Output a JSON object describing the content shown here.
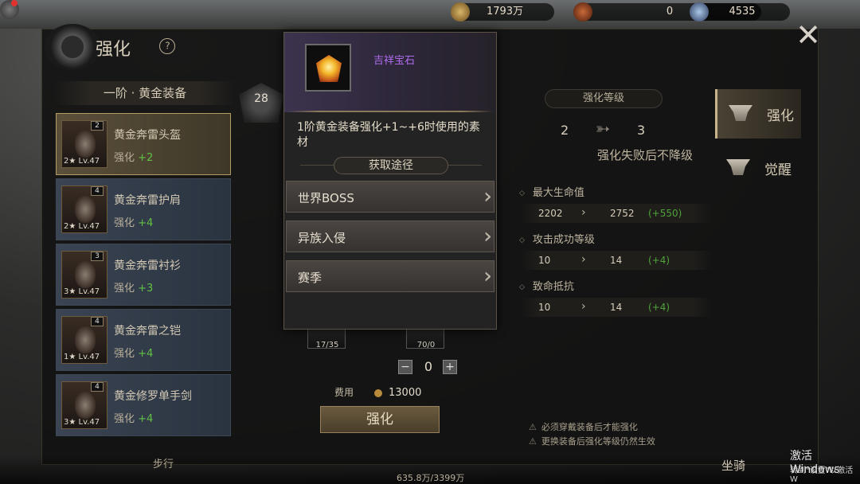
{
  "topbar": {
    "currency1": "1793万",
    "currency2": "0",
    "currency3": "4535"
  },
  "window": {
    "title": "强化",
    "help": "?",
    "close": "✕"
  },
  "list": {
    "header": "一阶 · 黄金装备",
    "items": [
      {
        "name": "黄金奔雷头盔",
        "count": "2",
        "lv": "2★ Lv.47",
        "enh": "+2"
      },
      {
        "name": "黄金奔雷护肩",
        "count": "4",
        "lv": "2★ Lv.47",
        "enh": "+4"
      },
      {
        "name": "黄金奔雷衬衫",
        "count": "3",
        "lv": "3★ Lv.47",
        "enh": "+3"
      },
      {
        "name": "黄金奔雷之铠",
        "count": "4",
        "lv": "1★ Lv.47",
        "enh": "+4"
      },
      {
        "name": "黄金修罗单手剑",
        "count": "4",
        "lv": "3★ Lv.47",
        "enh": "+4"
      }
    ],
    "enh_label": "强化"
  },
  "center": {
    "rank": "28",
    "mat1_count": "17/35",
    "mat2_count": "70/0",
    "stepper_minus": "−",
    "stepper_plus": "+",
    "stepper_value": "0",
    "cost_label": "费用",
    "cost_value": "13000",
    "enhance_button": "强化"
  },
  "stats": {
    "header": "强化等级",
    "from": "2",
    "to": "3",
    "no_drop": "强化失败后不降级",
    "rows": [
      {
        "title": "最大生命值",
        "a": "2202",
        "b": "2752",
        "d": "(+550)"
      },
      {
        "title": "攻击成功等级",
        "a": "10",
        "b": "14",
        "d": "(+4)"
      },
      {
        "title": "致命抵抗",
        "a": "10",
        "b": "14",
        "d": "(+4)"
      }
    ],
    "note1": "必须穿戴装备后才能强化",
    "note2": "更换装备后强化等级仍然生效"
  },
  "tabs": {
    "enhance": "强化",
    "awaken": "觉醒"
  },
  "hud": {
    "walk": "步行",
    "sit": "坐骑",
    "exp": "635.8万/3399万",
    "win_activate": "激活 Windows",
    "win_activate_sub": "转到\"设置\"以激活 W"
  },
  "tooltip": {
    "name": "吉祥宝石",
    "desc": "1阶黄金装备强化+1~+6时使用的素材",
    "source_header": "获取途径",
    "sources": [
      "世界BOSS",
      "异族入侵",
      "赛季"
    ]
  },
  "colors": {
    "item_name_purple": "#b06cf0",
    "increase_green": "#62c046",
    "gold_border": "#b59a62"
  }
}
